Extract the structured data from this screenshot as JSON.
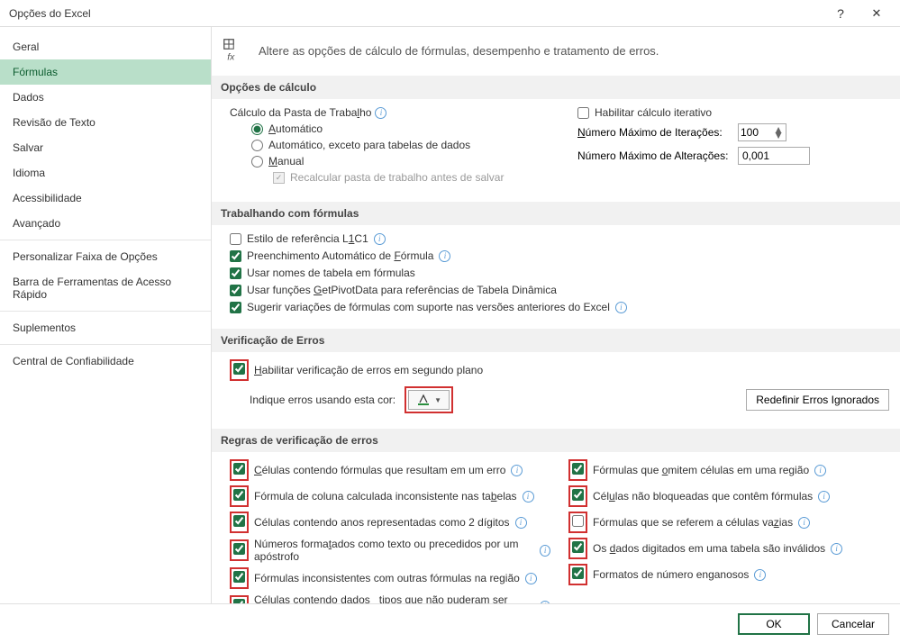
{
  "title": "Opções do Excel",
  "header_text": "Altere as opções de cálculo de fórmulas, desempenho e tratamento de erros.",
  "sidebar": {
    "items": [
      {
        "label": "Geral"
      },
      {
        "label": "Fórmulas"
      },
      {
        "label": "Dados"
      },
      {
        "label": "Revisão de Texto"
      },
      {
        "label": "Salvar"
      },
      {
        "label": "Idioma"
      },
      {
        "label": "Acessibilidade"
      },
      {
        "label": "Avançado"
      },
      {
        "label": "Personalizar Faixa de Opções"
      },
      {
        "label": "Barra de Ferramentas de Acesso Rápido"
      },
      {
        "label": "Suplementos"
      },
      {
        "label": "Central de Confiabilidade"
      }
    ]
  },
  "sections": {
    "calc": {
      "title": "Opções de cálculo",
      "workbook_calc": "Cálculo da Pasta de Trabalho",
      "auto": "Automático",
      "auto_except": "Automático, exceto para tabelas de dados",
      "manual": "Manual",
      "recalc": "Recalcular pasta de trabalho antes de salvar",
      "iter_enable": "Habilitar cálculo iterativo",
      "iter_max_label": "Número Máximo de Iterações:",
      "iter_max_value": "100",
      "iter_change_label": "Número Máximo de Alterações:",
      "iter_change_value": "0,001"
    },
    "formulas": {
      "title": "Trabalhando com fórmulas",
      "r1c1": "Estilo de referência L1C1",
      "autocomplete": "Preenchimento Automático de Fórmula",
      "table_names": "Usar nomes de tabela em fórmulas",
      "getpivot": "Usar funções GetPivotData para referências de Tabela Dinâmica",
      "suggest": "Sugerir variações de fórmulas com suporte nas versões anteriores do Excel"
    },
    "error_check": {
      "title": "Verificação de Erros",
      "enable_bg": "Habilitar verificação de erros em segundo plano",
      "color_label": "Indique erros usando esta cor:",
      "reset_btn": "Redefinir Erros Ignorados"
    },
    "rules": {
      "title": "Regras de verificação de erros",
      "left": [
        "Células contendo fórmulas que resultam em um erro",
        "Fórmula de coluna calculada inconsistente nas tabelas",
        "Células contendo anos representadas como 2 dígitos",
        "Números formatados como texto ou precedidos por um apóstrofo",
        "Fórmulas inconsistentes com outras fórmulas na região",
        "Células contendo dados _tipos que não puderam ser atualizados"
      ],
      "right": [
        "Fórmulas que omitem células em uma região",
        "Células não bloqueadas que contêm fórmulas",
        "Fórmulas que se referem a células vazias",
        "Os dados digitados em uma tabela são inválidos",
        "Formatos de número enganosos"
      ]
    }
  },
  "footer": {
    "ok": "OK",
    "cancel": "Cancelar"
  }
}
